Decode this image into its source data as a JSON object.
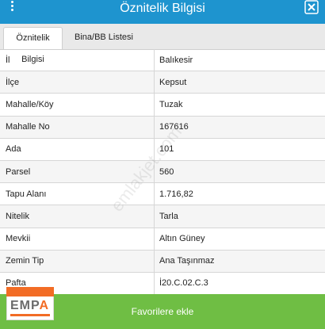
{
  "header": {
    "title": "Öznitelik Bilgisi",
    "color": "#1e94cf"
  },
  "tabs": [
    {
      "label": "Öznitelik Bilgisi",
      "active": true
    },
    {
      "label": "Bina/BB Listesi",
      "active": false
    }
  ],
  "rows": [
    {
      "key": "İl",
      "value": "Balıkesir"
    },
    {
      "key": "İlçe",
      "value": "Kepsut"
    },
    {
      "key": "Mahalle/Köy",
      "value": "Tuzak"
    },
    {
      "key": "Mahalle No",
      "value": "167616"
    },
    {
      "key": "Ada",
      "value": "101"
    },
    {
      "key": "Parsel",
      "value": "560"
    },
    {
      "key": "Tapu Alanı",
      "value": "1.716,82"
    },
    {
      "key": "Nitelik",
      "value": "Tarla"
    },
    {
      "key": "Mevkii",
      "value": "Altın Güney"
    },
    {
      "key": "Zemin Tip",
      "value": "Ana Taşınmaz"
    },
    {
      "key": "Pafta",
      "value": "İ20.C.02.C.3"
    }
  ],
  "watermark": "emlakjet.com",
  "footer": {
    "button_label": "Favorilere ekle",
    "color": "#6fbe44"
  },
  "logo": {
    "text_prefix": "EMP",
    "text_accent": "A",
    "accent_color": "#f26c25"
  }
}
